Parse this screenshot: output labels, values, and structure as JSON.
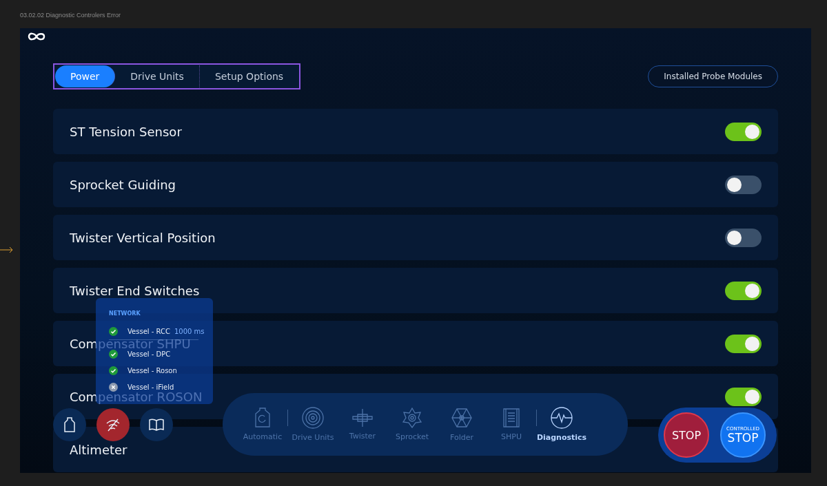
{
  "canvas": {
    "frame_label": "03.02.02 Diagnostic Controlers Error"
  },
  "tabs": [
    {
      "label": "Power",
      "selected": true
    },
    {
      "label": "Drive Units",
      "selected": false
    },
    {
      "label": "Setup Options",
      "selected": false
    }
  ],
  "header_button": "Installed Probe Modules",
  "modules": [
    {
      "name": "ST Tension Sensor",
      "on": true
    },
    {
      "name": "Sprocket Guiding",
      "on": false
    },
    {
      "name": "Twister Vertical Position",
      "on": false
    },
    {
      "name": "Twister End Switches",
      "on": true
    },
    {
      "name": "Compensator SHPU",
      "on": true
    },
    {
      "name": "Compensator ROSON",
      "on": true
    },
    {
      "name": "Altimeter"
    }
  ],
  "network_popup": {
    "title": "NETWORK",
    "items": [
      {
        "name": "Vessel - RCC",
        "latency": "1000 ms",
        "ok": true
      },
      {
        "name": "Vessel - DPC",
        "ok": true
      },
      {
        "name": "Vessel - Roson",
        "ok": true
      },
      {
        "name": "Vessel - iField",
        "ok": false
      }
    ]
  },
  "quick_buttons": [
    {
      "kind": "bag",
      "alert": false
    },
    {
      "kind": "network",
      "alert": true
    },
    {
      "kind": "book",
      "alert": false
    }
  ],
  "nav": [
    {
      "label": "Automatic",
      "kind": "automatic",
      "selected": false
    },
    {
      "label": "Drive Units",
      "kind": "drive",
      "selected": false
    },
    {
      "label": "Twister",
      "kind": "twister",
      "selected": false
    },
    {
      "label": "Sprocket",
      "kind": "sprocket",
      "selected": false
    },
    {
      "label": "Folder",
      "kind": "folder",
      "selected": false
    },
    {
      "label": "SHPU",
      "kind": "shpu",
      "selected": false
    },
    {
      "label": "Diagnostics",
      "kind": "diagnostics",
      "selected": true
    }
  ],
  "stop_button": "STOP",
  "controlled_stop": {
    "caption": "CONTROLLED",
    "label": "STOP"
  }
}
